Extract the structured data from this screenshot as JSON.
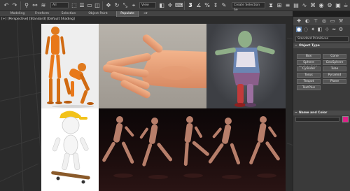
{
  "toolbar": {
    "icons": [
      "undo-icon",
      "redo-icon",
      "link-icon",
      "unlink-icon",
      "bind-space-warp-icon"
    ],
    "selection_filter": "All",
    "ref_coord": "View",
    "named_selection": "Create Selection Se"
  },
  "ribbon": {
    "tabs": [
      "Modeling",
      "Freeform",
      "Selection",
      "Object Paint",
      "Populate"
    ],
    "active_tab": "Populate"
  },
  "viewport": {
    "label": "[+] [Perspective] [Standard] [Default Shading]"
  },
  "command_panel": {
    "category_dropdown": "Standard Primitives",
    "object_type_header": "Object Type",
    "autogrid_label": "AutoGrid",
    "object_buttons": [
      "Box",
      "Cone",
      "Sphere",
      "GeoSphere",
      "Cylinder",
      "Tube",
      "Torus",
      "Pyramid",
      "Teapot",
      "Plane",
      "TextPlus"
    ],
    "name_color_header": "Name and Color",
    "swatch_color": "#e0208a"
  },
  "colors": {
    "toolbar_bg": "#3c3c3c",
    "panel_bg": "#3a3a3a",
    "active_blue": "#5f7fa8"
  }
}
